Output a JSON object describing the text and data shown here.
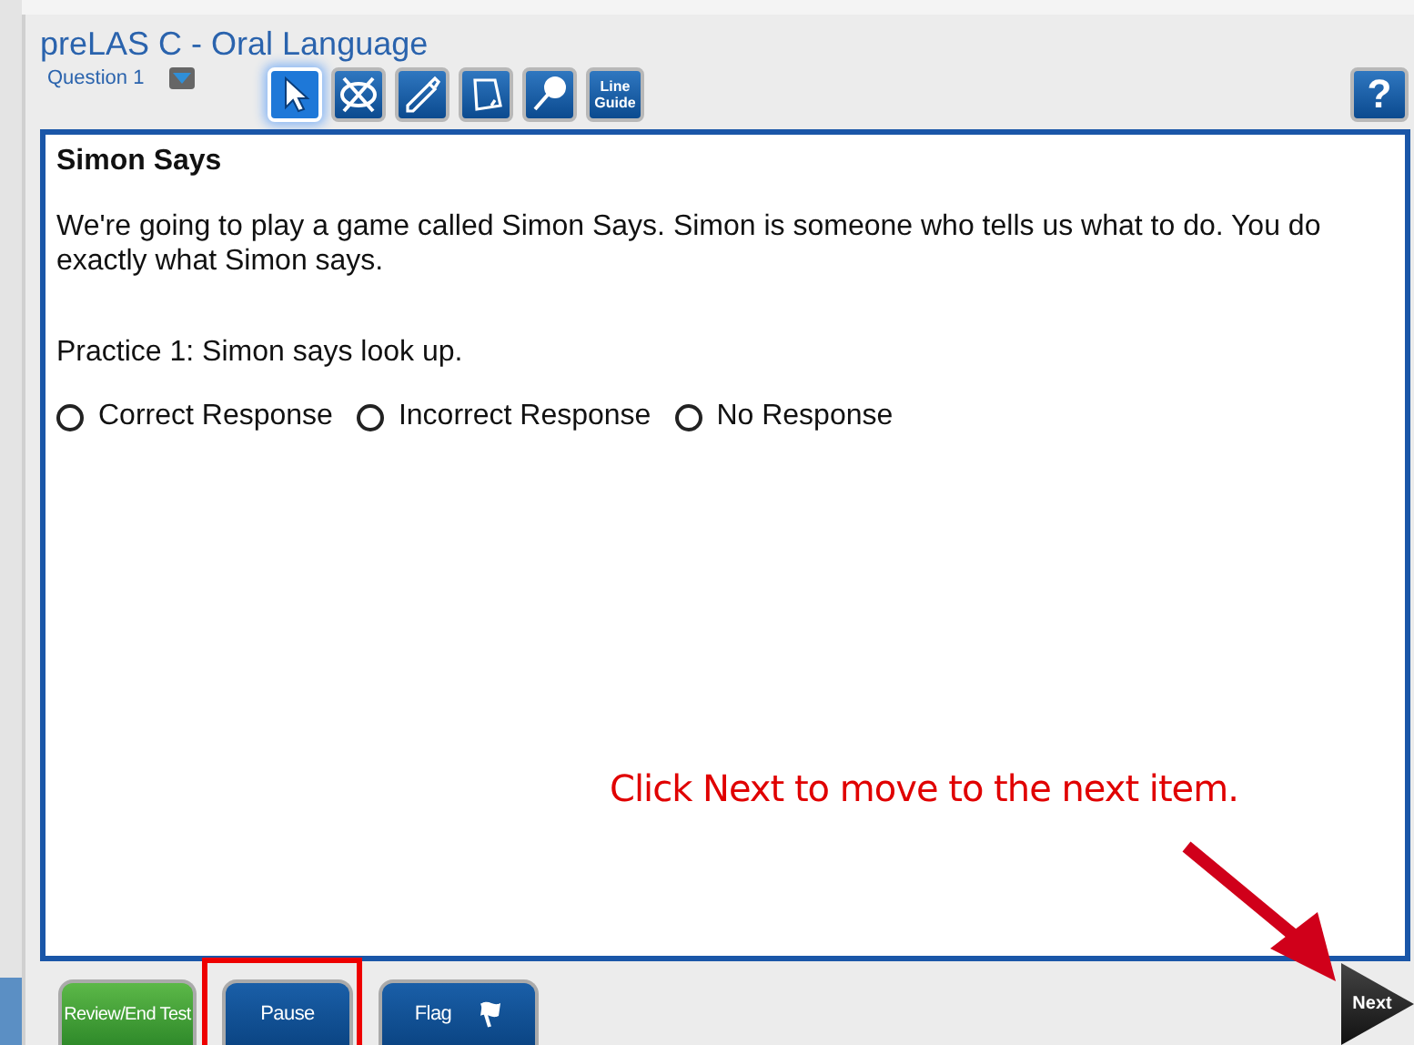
{
  "window": {
    "title": "preLAS C - Oral Language",
    "question": "Question 1"
  },
  "tools": [
    {
      "kind": "pointer",
      "selected": true
    },
    {
      "kind": "eliminator",
      "selected": false
    },
    {
      "kind": "highlighter",
      "selected": false
    },
    {
      "kind": "notepad",
      "selected": false
    },
    {
      "kind": "magnifier",
      "selected": false
    },
    {
      "kind": "text",
      "label": "Line Guide",
      "selected": false
    }
  ],
  "help": "?",
  "item": {
    "title": "Simon Says",
    "intro": "We're going to play a game called Simon Says. Simon is someone who tells us what to do. You do exactly what Simon says.",
    "prompt": "Practice 1: Simon says look up.",
    "options": [
      {
        "label": "Correct Response",
        "selected": false
      },
      {
        "label": "Incorrect Response",
        "selected": false
      },
      {
        "label": "No Response",
        "selected": false
      }
    ]
  },
  "annotation": "Click Next to move to the next item.",
  "footer": [
    {
      "label": "Review/End Test",
      "kind": "review"
    },
    {
      "label": "Pause",
      "kind": "pause"
    },
    {
      "label": "Flag",
      "kind": "flag"
    }
  ],
  "next": "Next"
}
